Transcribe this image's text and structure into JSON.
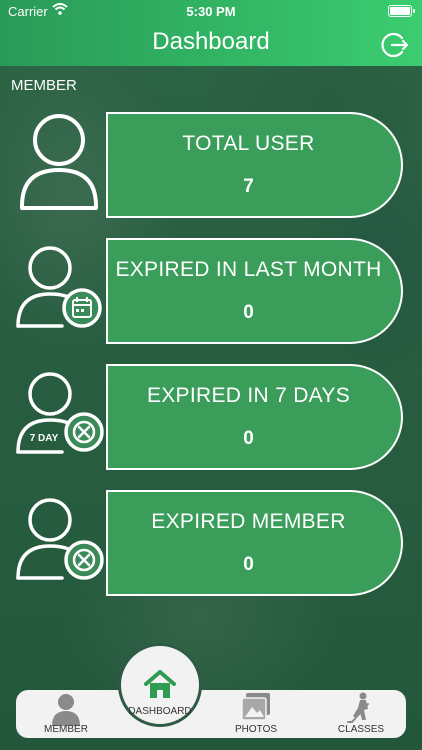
{
  "status_bar": {
    "carrier": "Carrier",
    "time": "5:30 PM"
  },
  "header": {
    "title": "Dashboard"
  },
  "section": {
    "label": "MEMBER"
  },
  "cards": [
    {
      "title": "TOTAL USER",
      "value": "7"
    },
    {
      "title": "EXPIRED IN LAST MONTH",
      "value": "0"
    },
    {
      "title": "EXPIRED IN 7 DAYS",
      "value": "0",
      "badge": "7 DAY"
    },
    {
      "title": "EXPIRED MEMBER",
      "value": "0"
    }
  ],
  "tabs": {
    "member": "MEMBER",
    "dashboard": "DASHBOARD",
    "photos": "PHOTOS",
    "classes": "CLASSES"
  },
  "colors": {
    "header_accent": "#33b865",
    "card_fill": "#3a9d5a",
    "dashboard_icon": "#2e9a52"
  },
  "icons": [
    "wifi-icon",
    "battery-icon",
    "logout-icon",
    "user-icon",
    "calendar-icon",
    "close-circle-icon",
    "home-icon",
    "photos-icon",
    "hockey-player-icon"
  ]
}
